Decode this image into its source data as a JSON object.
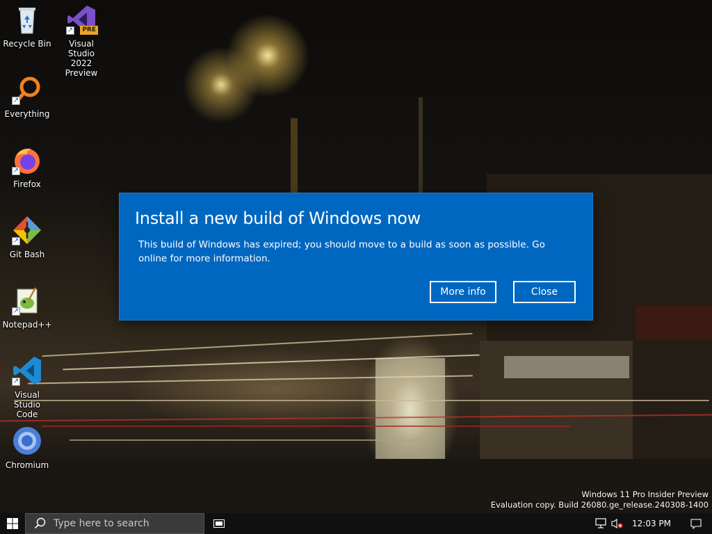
{
  "desktop_icons": [
    {
      "label": "Recycle Bin",
      "icon": "recycle-bin-icon"
    },
    {
      "label": "Visual Studio 2022 Preview",
      "icon": "visual-studio-icon",
      "badge": "PRE"
    },
    {
      "label": "Everything",
      "icon": "everything-search-icon"
    },
    {
      "label": "Firefox",
      "icon": "firefox-icon"
    },
    {
      "label": "Git Bash",
      "icon": "git-bash-icon"
    },
    {
      "label": "Notepad++",
      "icon": "notepadpp-icon"
    },
    {
      "label": "Visual Studio Code",
      "icon": "vscode-icon"
    },
    {
      "label": "Chromium",
      "icon": "chromium-icon"
    }
  ],
  "dialog": {
    "title": "Install a new build of Windows now",
    "message": "This build of Windows has expired; you should move to a build as soon as possible. Go online for more information.",
    "more_info_label": "More info",
    "close_label": "Close",
    "background_color": "#0067c0"
  },
  "watermark": {
    "line1": "Windows 11 Pro Insider Preview",
    "line2": "Evaluation copy. Build 26080.ge_release.240308-1400"
  },
  "taskbar": {
    "search_placeholder": "Type here to search",
    "clock": "12:03 PM"
  },
  "colors": {
    "taskbar": "#101010",
    "search_box": "#3a3a3a"
  }
}
